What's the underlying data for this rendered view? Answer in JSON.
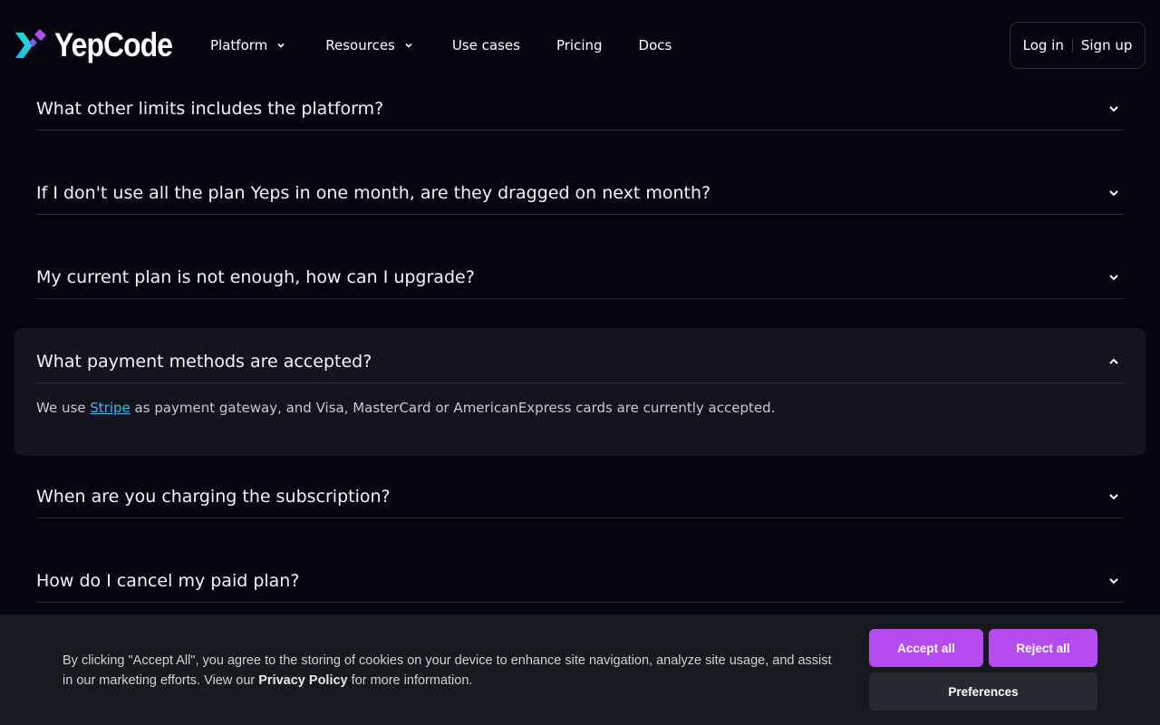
{
  "brand": {
    "name": "YepCode",
    "accent": "#b64cf0",
    "logo_colors": [
      "#2ad3e0",
      "#b64cf0"
    ]
  },
  "nav": {
    "items": [
      {
        "label": "Platform",
        "dropdown": true
      },
      {
        "label": "Resources",
        "dropdown": true
      },
      {
        "label": "Use cases",
        "dropdown": false
      },
      {
        "label": "Pricing",
        "dropdown": false
      },
      {
        "label": "Docs",
        "dropdown": false
      }
    ]
  },
  "auth": {
    "login": "Log in",
    "signup": "Sign up"
  },
  "faq": {
    "items": [
      {
        "question": "What other limits includes the platform?",
        "expanded": false
      },
      {
        "question": "If I don't use all the plan Yeps in one month, are they dragged on next month?",
        "expanded": false
      },
      {
        "question": "My current plan is not enough, how can I upgrade?",
        "expanded": false
      },
      {
        "question": "What payment methods are accepted?",
        "expanded": true
      },
      {
        "question": "When are you charging the subscription?",
        "expanded": false
      },
      {
        "question": "How do I cancel my paid plan?",
        "expanded": false
      }
    ],
    "answer": {
      "prefix": "We use ",
      "link": "Stripe",
      "suffix": " as payment gateway, and Visa, MasterCard or AmericanExpress cards are currently accepted."
    }
  },
  "cookie": {
    "text_1": "By clicking \"Accept All\", you agree to the storing of cookies on your device to enhance site navigation, analyze site usage, and assist in our marketing efforts. View our ",
    "policy_link": "Privacy Policy",
    "text_2": " for more information.",
    "accept": "Accept all",
    "reject": "Reject all",
    "preferences": "Preferences"
  }
}
